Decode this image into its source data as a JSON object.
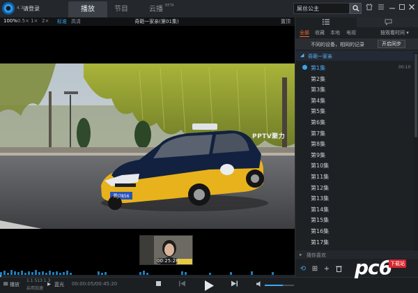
{
  "titlebar": {
    "logo_number": "4.3",
    "login": "请登录",
    "tabs": [
      {
        "label": "播放",
        "active": true
      },
      {
        "label": "节目",
        "active": false
      },
      {
        "label": "云播",
        "active": false
      }
    ],
    "beta": "BETA",
    "search_value": "屌丝公主",
    "window_buttons": [
      "skin-icon",
      "menu-icon",
      "minimize-icon",
      "restore-icon",
      "close-icon"
    ]
  },
  "player_bar": {
    "zoom_options": [
      {
        "label": "100%",
        "active": true
      },
      {
        "label": "0.5×",
        "active": false
      },
      {
        "label": "1×",
        "active": false
      },
      {
        "label": "2×",
        "active": false
      }
    ],
    "quality_options": [
      {
        "label": "标准",
        "active": true
      },
      {
        "label": "高清",
        "active": false
      }
    ],
    "video_title": "奇葩一家亲(第01集)",
    "right_label": "置顶"
  },
  "video": {
    "watermark": "PPTV聚力",
    "plate": "晋J7856",
    "preview_time": "00:25:28"
  },
  "controls": {
    "left_label": "播放",
    "left_info_1": "1.1 513 1.3",
    "left_info_2": "启用加速",
    "quality_btn": "蓝光",
    "time": "00:00:05/00:45:20",
    "volume_level": 0.62
  },
  "panel": {
    "tabs": [
      {
        "icon": "list-icon",
        "active": true
      },
      {
        "icon": "chat-icon",
        "active": false
      }
    ],
    "filters": [
      {
        "label": "全部",
        "active": true
      },
      {
        "label": "收藏",
        "active": false
      },
      {
        "label": "本地",
        "active": false
      },
      {
        "label": "电视",
        "active": false
      }
    ],
    "sort": "按观看时间 ▾",
    "sync_text": "不同的设备，相同的记录",
    "sync_button": "开启同步",
    "series_title": "奇葩一家亲",
    "episodes": [
      {
        "label": "第1集",
        "time": "00:10",
        "current": true
      },
      {
        "label": "第2集"
      },
      {
        "label": "第3集"
      },
      {
        "label": "第4集"
      },
      {
        "label": "第5集"
      },
      {
        "label": "第6集"
      },
      {
        "label": "第7集"
      },
      {
        "label": "第8集"
      },
      {
        "label": "第9集"
      },
      {
        "label": "第10集"
      },
      {
        "label": "第11集"
      },
      {
        "label": "第12集"
      },
      {
        "label": "第13集"
      },
      {
        "label": "第14集"
      },
      {
        "label": "第15集"
      },
      {
        "label": "第16集"
      },
      {
        "label": "第17集"
      }
    ],
    "recommend": "猜你喜欢",
    "site_logo": "pc6",
    "site_logo_sub": "下载站"
  },
  "colors": {
    "accent_blue": "#3aa3ee",
    "accent_orange": "#f46a2c",
    "panel_bg": "#1e2124",
    "taxi_yellow": "#e8b21c",
    "taxi_blue": "#12213f"
  }
}
